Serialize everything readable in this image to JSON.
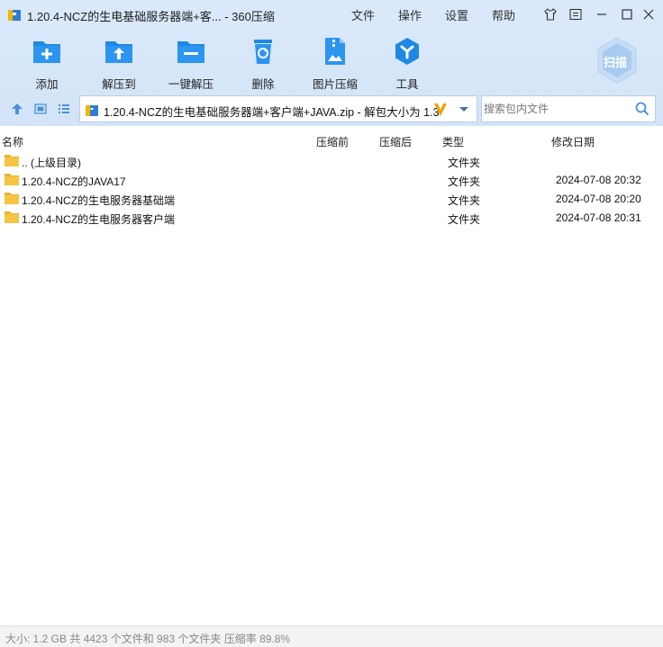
{
  "window": {
    "title": "1.20.4-NCZ的生电基础服务器端+客... - 360压缩",
    "menu": [
      "文件",
      "操作",
      "设置",
      "帮助"
    ]
  },
  "toolbar": {
    "items": [
      {
        "label": "添加",
        "icon": "add-folder-icon"
      },
      {
        "label": "解压到",
        "icon": "extract-to-icon"
      },
      {
        "label": "一键解压",
        "icon": "one-click-extract-icon"
      },
      {
        "label": "删除",
        "icon": "recycle-bin-icon"
      },
      {
        "label": "图片压缩",
        "icon": "image-compress-icon"
      },
      {
        "label": "工具",
        "icon": "tools-icon"
      }
    ],
    "scan_label": "扫描"
  },
  "address": {
    "path": "1.20.4-NCZ的生电基础服务器端+客户端+JAVA.zip - 解包大小为 1.3",
    "search_placeholder": "搜索包内文件"
  },
  "list": {
    "columns": {
      "name": "名称",
      "before": "压缩前",
      "after": "压缩后",
      "type": "类型",
      "modified": "修改日期"
    },
    "rows": [
      {
        "name": ".. (上级目录)",
        "type": "文件夹",
        "modified": ""
      },
      {
        "name": "1.20.4-NCZ的JAVA17",
        "type": "文件夹",
        "modified": "2024-07-08 20:32"
      },
      {
        "name": "1.20.4-NCZ的生电服务器基础端",
        "type": "文件夹",
        "modified": "2024-07-08 20:20"
      },
      {
        "name": "1.20.4-NCZ的生电服务器客户端",
        "type": "文件夹",
        "modified": "2024-07-08 20:31"
      }
    ]
  },
  "status": {
    "text": "大小: 1.2 GB 共 4423 个文件和 983 个文件夹 压缩率 89.8%"
  },
  "colors": {
    "accent": "#1e88e5",
    "toolbar_bg": "#d7e6f9",
    "folder": "#f5c542"
  }
}
